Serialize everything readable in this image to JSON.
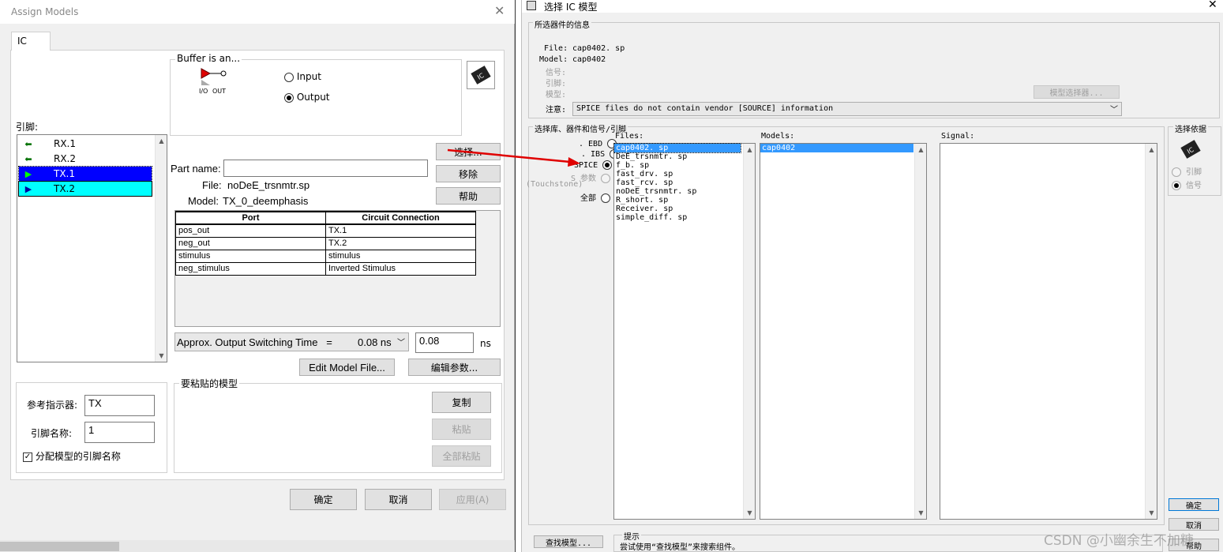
{
  "left_dialog": {
    "title": "Assign Models",
    "tab": "IC",
    "buffer_group": "Buffer is an...",
    "io_label": "I/O",
    "out_label": "OUT",
    "radio_input": "Input",
    "radio_output": "Output",
    "pins_label": "引脚:",
    "pins": [
      {
        "name": "RX.1",
        "icon": "arrow-left-icon",
        "selected": false
      },
      {
        "name": "RX.2",
        "icon": "arrow-left-icon",
        "selected": false
      },
      {
        "name": "TX.1",
        "icon": "buffer-out-icon",
        "selected": true
      },
      {
        "name": "TX.2",
        "icon": "buffer-out-icon",
        "selected": "alt"
      }
    ],
    "part_name_label": "Part name:",
    "part_name_value": "",
    "file_label": "File:",
    "file_value": "noDeE_trsnmtr.sp",
    "model_label": "Model:",
    "model_value": "TX_0_deemphasis",
    "btn_select": "选择...",
    "btn_remove": "移除",
    "btn_help": "帮助",
    "table_headers": [
      "Port",
      "Circuit Connection"
    ],
    "table_rows": [
      [
        "pos_out",
        "TX.1"
      ],
      [
        "neg_out",
        "TX.2"
      ],
      [
        "stimulus",
        "stimulus"
      ],
      [
        "neg_stimulus",
        "Inverted Stimulus"
      ]
    ],
    "switch_time_label": "Approx. Output Switching Time   =",
    "switch_time_select": "0.08 ns",
    "switch_time_value": "0.08",
    "switch_time_unit": "ns",
    "btn_edit_model": "Edit Model File...",
    "btn_edit_params": "编辑参数...",
    "ref_label": "参考指示器:",
    "ref_value": "TX",
    "pin_name_label": "引脚名称:",
    "pin_name_value": "1",
    "assign_checkbox": "分配模型的引脚名称",
    "paste_group": "要粘贴的模型",
    "btn_copy": "复制",
    "btn_paste": "粘贴",
    "btn_paste_all": "全部粘贴",
    "btn_ok": "确定",
    "btn_cancel": "取消",
    "btn_apply": "应用(A)"
  },
  "right_dialog": {
    "title": "选择 IC 模型",
    "info_group": "所选器件的信息",
    "info_file_label": "File:",
    "info_file_value": "cap0402. sp",
    "info_model_label": "Model:",
    "info_model_value": "cap0402",
    "info_signal_label": "信号:",
    "info_pin_label": "引脚:",
    "info_modeltype_label": "模型:",
    "info_note_label": "注意:",
    "btn_model_selector": "模型选择器...",
    "note_value": "SPICE files do not contain vendor [SOURCE] information",
    "lib_group": "选择库、器件和信号/引脚",
    "radio_ebd": ". EBD",
    "radio_ibs": ". IBS",
    "radio_spice": "SPICE",
    "radio_s": "S 参数",
    "touchstone": "(Touchstone)",
    "radio_all": "全部",
    "files_label": "Files:",
    "files": [
      "cap0402. sp",
      "DeE_trsnmtr. sp",
      "f_b. sp",
      "fast_drv. sp",
      "fast_rcv. sp",
      "noDeE_trsnmtr. sp",
      "R_short. sp",
      "Receiver. sp",
      "simple_diff. sp"
    ],
    "models_label": "Models:",
    "models": [
      "cap0402"
    ],
    "signal_label": "Signal:",
    "basis_group": "选择依据",
    "basis_pin": "引脚",
    "basis_signal": "信号",
    "btn_ok": "确定",
    "btn_cancel": "取消",
    "btn_help": "帮助",
    "btn_find": "查找模型...",
    "hint_title": "提示",
    "hint_text": "尝试使用“查找模型”来搜索组件。"
  },
  "watermark": "CSDN @小幽余生不加糖",
  "colors": {
    "selected_blue": "#0000ff",
    "selected_cyan": "#00ffff",
    "list_select": "#3399ff",
    "arrow_red": "#e00000"
  }
}
